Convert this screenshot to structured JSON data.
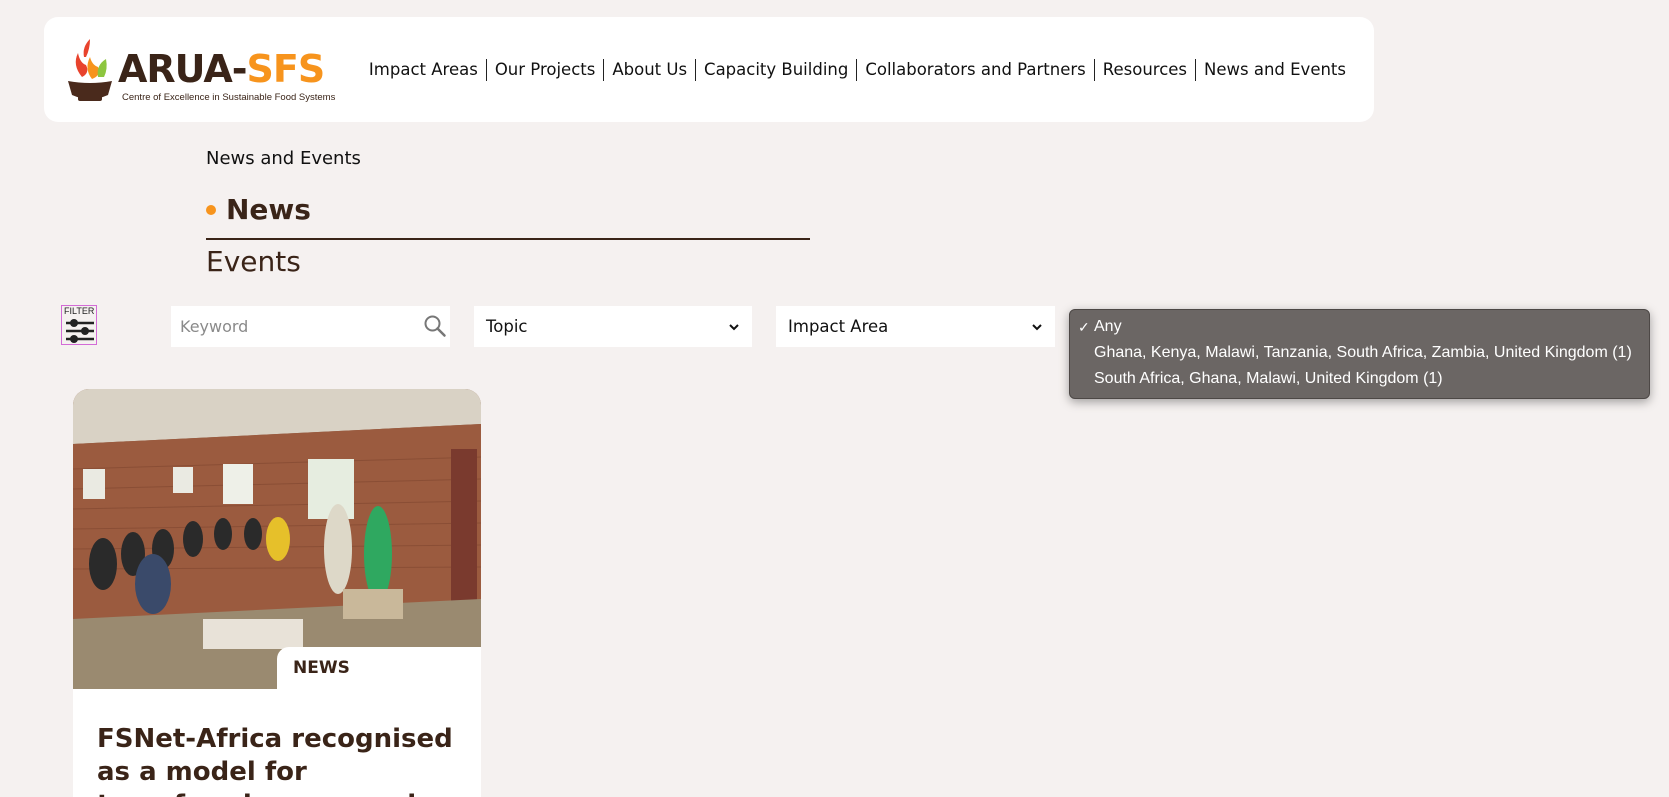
{
  "brand": {
    "name_dark": "ARUA-",
    "name_orange": "SFS",
    "tagline": "Centre of Excellence in Sustainable Food Systems"
  },
  "nav": {
    "items": [
      {
        "label": "Impact Areas"
      },
      {
        "label": "Our Projects"
      },
      {
        "label": "About Us"
      },
      {
        "label": "Capacity Building"
      },
      {
        "label": "Collaborators and Partners"
      },
      {
        "label": "Resources"
      },
      {
        "label": "News and Events"
      }
    ]
  },
  "page": {
    "breadcrumb": "News and Events",
    "tab_news": "News",
    "tab_events": "Events"
  },
  "filters": {
    "filter_label": "FILTER",
    "keyword_placeholder": "Keyword",
    "topic": "Topic",
    "impact_area": "Impact Area"
  },
  "dropdown": {
    "check_glyph": "✓",
    "options": [
      {
        "label": "Any",
        "selected": true
      },
      {
        "label": "Ghana, Kenya, Malawi, Tanzania, South Africa, Zambia, United Kingdom (1)",
        "selected": false
      },
      {
        "label": "South Africa, Ghana, Malawi, United Kingdom (1)",
        "selected": false
      }
    ]
  },
  "card": {
    "badge": "NEWS",
    "title": "FSNet-Africa recognised as a model for transforming research"
  },
  "colors": {
    "accent": "#f7941d",
    "brand_brown": "#3a2418",
    "background": "#f5f1f0"
  }
}
